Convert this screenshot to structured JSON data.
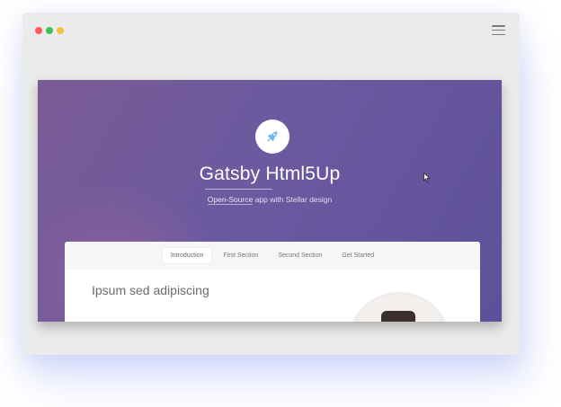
{
  "window": {
    "traffic_lights": {
      "close_color": "#fc5a58",
      "minimize_color": "#40c25a",
      "maximize_color": "#f2c33d"
    },
    "menu_icon": "hamburger-menu-icon"
  },
  "hero": {
    "logo_icon": "rocket-icon",
    "logo_color": "#6fb9ea",
    "title": "Gatsby Html5Up",
    "subtitle_link": "Open-Source",
    "subtitle_rest": " app with Stellar design"
  },
  "nav": {
    "tabs": [
      {
        "label": "Introduction",
        "active": true
      },
      {
        "label": "First Section",
        "active": false
      },
      {
        "label": "Second Section",
        "active": false
      },
      {
        "label": "Get Started",
        "active": false
      }
    ]
  },
  "main": {
    "section_heading": "Ipsum sed adipiscing"
  },
  "colors": {
    "gradient_start": "#7b5b94",
    "gradient_end": "#5e509a",
    "browser_chrome": "#ebebeb"
  }
}
